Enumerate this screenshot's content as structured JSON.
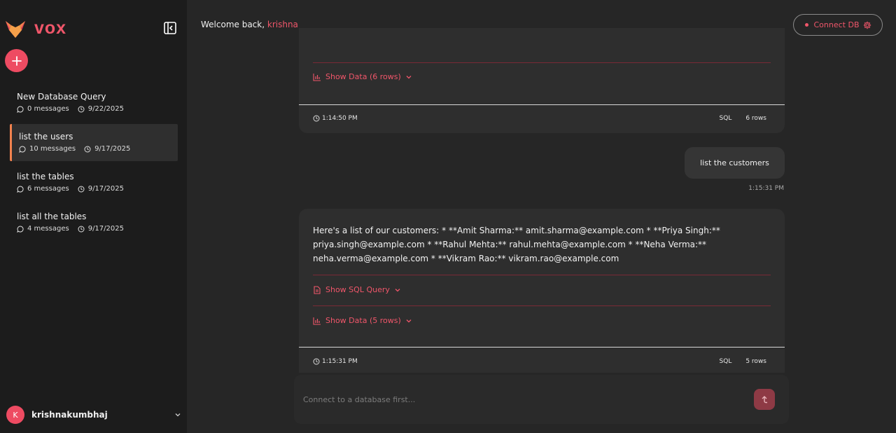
{
  "app": {
    "brand": "vox"
  },
  "sidebar": {
    "chats": [
      {
        "title": "New Database Query",
        "messages": "0 messages",
        "date": "9/22/2025",
        "active": false
      },
      {
        "title": "list the users",
        "messages": "10 messages",
        "date": "9/17/2025",
        "active": true
      },
      {
        "title": "list the tables",
        "messages": "6 messages",
        "date": "9/17/2025",
        "active": false
      },
      {
        "title": "list all the tables",
        "messages": "4 messages",
        "date": "9/17/2025",
        "active": false
      }
    ],
    "user": {
      "initial": "K",
      "name": "krishnakumbhaj"
    }
  },
  "header": {
    "welcome_prefix": "Welcome back,",
    "user_name": "krishna",
    "connect_label": "Connect DB"
  },
  "conversation": {
    "card1": {
      "show_data_label": "Show Data (6 rows)",
      "time": "1:14:50 PM",
      "type": "SQL",
      "rows": "6 rows"
    },
    "user_message": {
      "text": "list the customers",
      "time": "1:15:31 PM"
    },
    "card2": {
      "text": "Here's a list of our customers: * **Amit Sharma:** amit.sharma@example.com * **Priya Singh:** priya.singh@example.com * **Rahul Mehta:** rahul.mehta@example.com * **Neha Verma:** neha.verma@example.com * **Vikram Rao:** vikram.rao@example.com",
      "show_sql_label": "Show SQL Query",
      "show_data_label": "Show Data (5 rows)",
      "time": "1:15:31 PM",
      "type": "SQL",
      "rows": "5 rows"
    }
  },
  "input": {
    "placeholder": "Connect to a database first..."
  },
  "colors": {
    "accent": "#ee4b62",
    "active_border": "#f2824e",
    "sidebar_bg": "#1c1c1c",
    "main_bg": "#262626"
  }
}
